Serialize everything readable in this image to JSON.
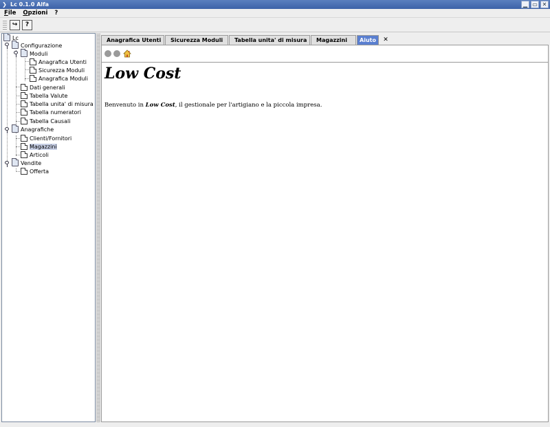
{
  "window": {
    "title": "Lc 0.1.0 Alfa",
    "min": "▁",
    "max": "▭",
    "close": "✕",
    "sys": "❯"
  },
  "menu": [
    "File",
    "Opzioni",
    "?"
  ],
  "toolbar": {
    "exit_label": "↪",
    "help_label": "?"
  },
  "tree": {
    "root": "Lc",
    "configurazione": "Configurazione",
    "moduli": "Moduli",
    "anagrafica_utenti": "Anagrafica Utenti",
    "sicurezza_moduli": "Sicurezza Moduli",
    "anagrafica_moduli": "Anagrafica Moduli",
    "dati_generali": "Dati generali",
    "tabella_valute": "Tabella Valute",
    "tabella_unita": "Tabella unita' di misura",
    "tabella_numeratori": "Tabella numeratori",
    "tabella_causali": "Tabella Causali",
    "anagrafiche": "Anagrafiche",
    "clienti_fornitori": "Clienti/Fornitori",
    "magazzini": "Magazzini",
    "articoli": "Articoli",
    "vendite": "Vendite",
    "offerta": "Offerta"
  },
  "tabs": [
    "Anagrafica Utenti",
    "Sicurezza Moduli",
    "Tabella unita' di misura",
    "Magazzini",
    "Aiuto"
  ],
  "tab_close": "✕",
  "help": {
    "title": "Low Cost",
    "intro_before": "Benvenuto in ",
    "intro_bold": "Low Cost",
    "intro_after": ", il gestionale per l'artigiano e la piccola impresa."
  },
  "colors": {
    "titlebar": "#4a6fb3",
    "active_tab": "#5a7fd0",
    "selection": "#c8d0e6"
  }
}
